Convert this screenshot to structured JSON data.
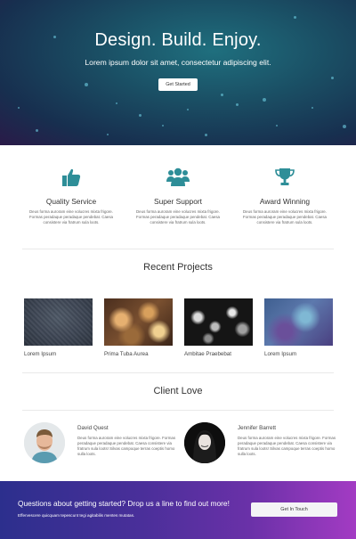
{
  "hero": {
    "title": "Design. Build. Enjoy.",
    "subtitle": "Lorem ipsum dolor sit amet, consectetur adipiscing elit.",
    "button": "Get Started"
  },
  "features": [
    {
      "icon": "thumbs-up-icon",
      "title": "Quality Service",
      "description": "Deus forma auroram eine volucres mixta frigore. Formas peradaque peradaque pendebat. Caesa consistere via fratrum sula loots."
    },
    {
      "icon": "users-icon",
      "title": "Super Support",
      "description": "Deus forma auroram eine volucres mixta frigore. Formas peradaque peradaque pendebat. Caesa consistere via fratrum sula loots."
    },
    {
      "icon": "trophy-icon",
      "title": "Award Winning",
      "description": "Deus forma auroram eine volucres mixta frigore. Formas peradaque peradaque pendebat. Caesa consistere via fratrum sula loots."
    }
  ],
  "projects": {
    "title": "Recent Projects",
    "items": [
      {
        "label": "Lorem Ipsum"
      },
      {
        "label": "Prima Tuba Aurea"
      },
      {
        "label": "Ambitae Praebebat"
      },
      {
        "label": "Lorem Ipsum"
      }
    ]
  },
  "clients": {
    "title": "Client Love",
    "items": [
      {
        "name": "David Quest",
        "description": "Deus forma auroram eine volucres mixta frigore. Formas peradaque peradaque pendebat. Caesa consistere via fratrum sula loots! Silvas campoque terras coeptis homo sulla loots."
      },
      {
        "name": "Jennifer Barrett",
        "description": "Deus forma auroram eine volucres mixta frigore. Formas peradaque peradaque pendebat. Caesa consistere via fratrum sula loots! Silvas campoque terras coeptis homo sulla loots."
      }
    ]
  },
  "cta": {
    "title": "Questions about getting started? Drop us a line to find out more!",
    "subtitle": "Effervescere quicquam tepescunt tegi agitabilis mentes mutatas.",
    "button": "Get In Touch"
  },
  "colors": {
    "accent": "#2e8e98"
  }
}
